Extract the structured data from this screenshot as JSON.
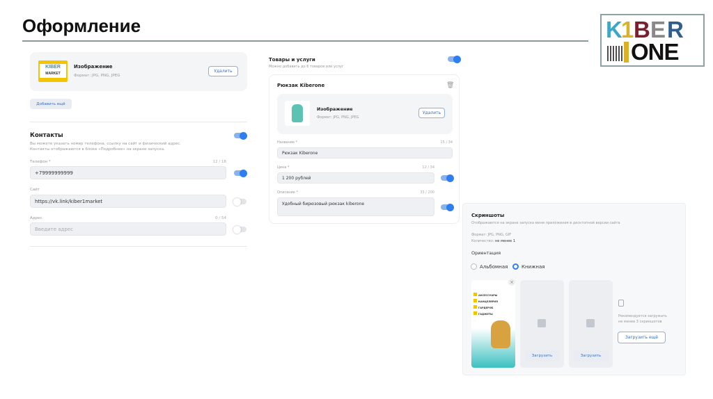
{
  "page": {
    "title": "Оформление"
  },
  "logo": {
    "line1": "KIBER",
    "line2": "ONE"
  },
  "image_block": {
    "logo_text1": "KIBER",
    "logo_text2": "MARKET",
    "title": "Изображение",
    "format": "Формат: JPG, PNG, JPEG",
    "delete": "Удалить",
    "add_more": "Добавить ещё"
  },
  "contacts": {
    "title": "Контакты",
    "desc1": "Вы можете указать номер телефона, ссылку на сайт и физический адрес.",
    "desc2": "Контакты отображаются в блоке «Подробнее» на экране запуска.",
    "phone": {
      "label": "Телефон *",
      "count": "12 / 18",
      "value": "+79999999999"
    },
    "site": {
      "label": "Сайт",
      "value": "https://vk.link/kiber1market"
    },
    "address": {
      "label": "Адрес",
      "count": "0 / 54",
      "placeholder": "Введите адрес"
    }
  },
  "products": {
    "title": "Товары и услуги",
    "subtitle": "Можно добавить до 6 товаров или услуг",
    "item": {
      "title": "Рюкзак Kiberone",
      "image_title": "Изображение",
      "image_format": "Формат: JPG, PNG, JPEG",
      "delete": "Удалить",
      "name": {
        "label": "Название *",
        "count": "15 / 34",
        "value": "Рюкзак Kiberone"
      },
      "price": {
        "label": "Цена *",
        "count": "12 / 34",
        "value": "1 200 рублей"
      },
      "description": {
        "label": "Описание *",
        "count": "33 / 200",
        "value": "Удобный бирюзовый рюкзак kiberone"
      }
    }
  },
  "screenshots": {
    "title": "Скриншоты",
    "subtitle": "Отображаются на экране запуска мини приложения в десктопной версии сайта",
    "format": "Формат: JPG, PNG, GIF",
    "count_label": "Количество:",
    "count_value": "не менее 1",
    "orientation": "Ориентация",
    "landscape": "Альбомная",
    "portrait": "Книжная",
    "preview_items": [
      "АКСЕССУАРЫ",
      "КАНЦЕЛЯРИЯ",
      "ГАРДЕРОБ",
      "ГАДЖЕТЫ"
    ],
    "upload": "Загрузить",
    "hint1": "Рекомендуется загружать",
    "hint2": "не менее 3 скриншотов",
    "upload_more": "Загрузить ещё"
  },
  "colors": {
    "accent": "#2d7ef0"
  }
}
